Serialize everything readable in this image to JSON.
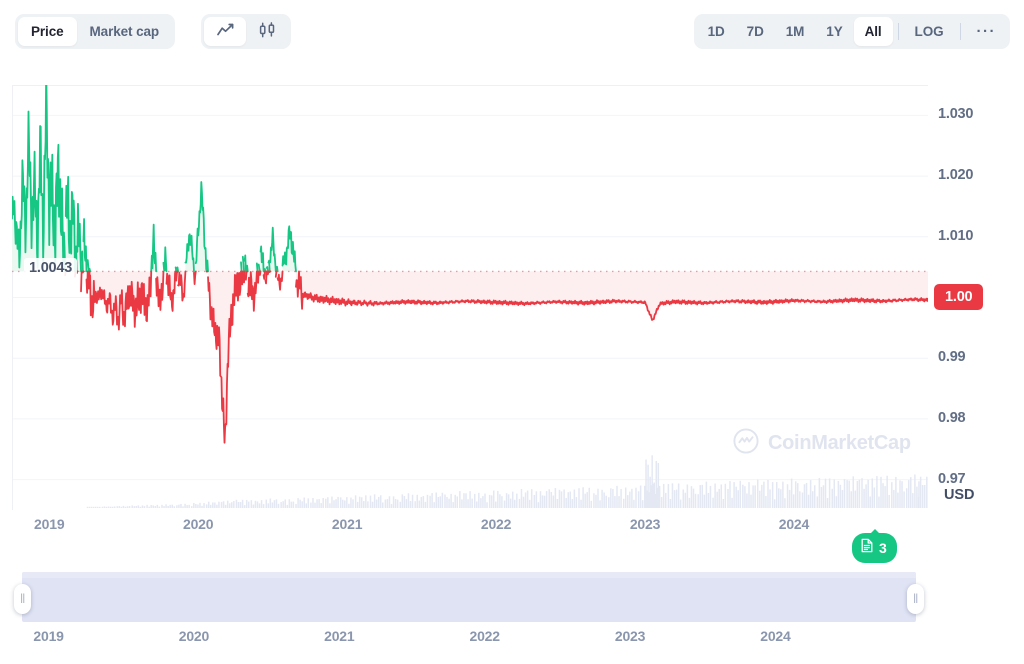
{
  "toolbar": {
    "metric_toggle": [
      {
        "label": "Price",
        "active": true,
        "name": "price"
      },
      {
        "label": "Market cap",
        "active": false,
        "name": "market-cap"
      }
    ],
    "chart_type_toggle": [
      {
        "icon": "line-chart-icon",
        "active": true,
        "name": "line"
      },
      {
        "icon": "candlestick-chart-icon",
        "active": false,
        "name": "candlestick"
      }
    ],
    "ranges": [
      {
        "label": "1D",
        "active": false
      },
      {
        "label": "7D",
        "active": false
      },
      {
        "label": "1M",
        "active": false
      },
      {
        "label": "1Y",
        "active": false
      },
      {
        "label": "All",
        "active": true
      }
    ],
    "log_label": "LOG",
    "more_label": "···"
  },
  "watermark": {
    "text": "CoinMarketCap",
    "logo": "coinmarketcap-logo-icon"
  },
  "news_badge": {
    "count": "3",
    "icon": "news-document-icon"
  },
  "annotations": {
    "price_flag": "1.0043",
    "current_price_badge": "1.00",
    "currency_unit": "USD"
  },
  "colors": {
    "up": "#16c784",
    "down": "#ea3943",
    "up_fill": "#eaf8f1",
    "down_fill": "#fdeef0",
    "grid": "#f2f4f7",
    "volume": "#e4e8f3",
    "badge_red": "#ea3943",
    "badge_green": "#16c784",
    "slider_track": "#dfe3f4",
    "text_muted": "#8a96ad"
  },
  "chart_data": {
    "type": "line",
    "title": "",
    "xlabel": "",
    "ylabel": "USD",
    "grid": true,
    "legend": "none",
    "ylim": [
      0.965,
      1.035
    ],
    "yticks": [
      "1.030",
      "1.020",
      "1.010",
      "1.00",
      "0.99",
      "0.98",
      "0.97"
    ],
    "ytick_values": [
      1.03,
      1.02,
      1.01,
      1.0,
      0.99,
      0.98,
      0.97
    ],
    "xticks": [
      "2019",
      "2020",
      "2021",
      "2022",
      "2023",
      "2024"
    ],
    "xtick_values": [
      2019,
      2020,
      2021,
      2022,
      2023,
      2024
    ],
    "xlim": [
      2018.75,
      2024.9
    ],
    "reference_line": 1.0043,
    "reference_line_label": "1.0043",
    "series": [
      {
        "name": "Price (USD)",
        "color_above_reference": "#16c784",
        "color_below_reference": "#ea3943",
        "x": [
          2018.78,
          2018.8,
          2018.82,
          2018.84,
          2018.86,
          2018.88,
          2018.9,
          2018.92,
          2018.94,
          2018.96,
          2018.98,
          2019.0,
          2019.02,
          2019.04,
          2019.06,
          2019.08,
          2019.1,
          2019.12,
          2019.14,
          2019.16,
          2019.18,
          2019.2,
          2019.22,
          2019.24,
          2019.26,
          2019.28,
          2019.3,
          2019.32,
          2019.34,
          2019.36,
          2019.38,
          2019.4,
          2019.42,
          2019.44,
          2019.46,
          2019.48,
          2019.5,
          2019.54,
          2019.58,
          2019.62,
          2019.66,
          2019.7,
          2019.74,
          2019.78,
          2019.82,
          2019.86,
          2019.9,
          2019.94,
          2019.98,
          2020.02,
          2020.06,
          2020.1,
          2020.14,
          2020.18,
          2020.2,
          2020.22,
          2020.24,
          2020.26,
          2020.28,
          2020.3,
          2020.34,
          2020.38,
          2020.42,
          2020.46,
          2020.5,
          2020.54,
          2020.58,
          2020.62,
          2020.66,
          2020.7,
          2020.8,
          2020.9,
          2021.0,
          2021.2,
          2021.4,
          2021.6,
          2021.8,
          2022.0,
          2022.2,
          2022.4,
          2022.6,
          2022.8,
          2023.0,
          2023.05,
          2023.1,
          2023.2,
          2023.4,
          2023.6,
          2023.8,
          2024.0,
          2024.2,
          2024.4,
          2024.6,
          2024.8,
          2024.88
        ],
        "y": [
          1.013,
          1.0048,
          1.0215,
          1.01,
          1.027,
          1.013,
          1.019,
          1.009,
          1.025,
          1.011,
          1.032,
          1.015,
          1.018,
          1.0095,
          1.023,
          1.012,
          1.008,
          1.016,
          1.01,
          1.0145,
          1.006,
          1.011,
          1.005,
          1.009,
          1.003,
          1.0005,
          0.9985,
          1.0012,
          0.9995,
          1.002,
          0.9975,
          1.0008,
          0.9965,
          0.999,
          0.996,
          0.9995,
          0.997,
          1.0008,
          0.998,
          1.001,
          0.9975,
          1.009,
          0.9985,
          1.006,
          0.999,
          1.0045,
          1.0002,
          1.011,
          1.0035,
          1.018,
          1.004,
          0.9955,
          0.993,
          0.9755,
          0.9905,
          0.9965,
          0.9998,
          1.0035,
          1.0008,
          1.006,
          1.002,
          1.0005,
          1.007,
          1.003,
          1.0095,
          1.0018,
          1.006,
          1.011,
          1.003,
          1.0005,
          0.9998,
          0.9995,
          0.9992,
          0.999,
          0.9993,
          0.9991,
          0.9994,
          0.9992,
          0.999,
          0.9993,
          0.9991,
          0.9994,
          0.9992,
          0.9962,
          0.999,
          0.9993,
          0.9991,
          0.9994,
          0.9992,
          0.9995,
          0.9993,
          0.9996,
          0.9994,
          0.9997,
          0.9996
        ]
      }
    ],
    "volume": {
      "name": "Volume",
      "color": "#e4e8f3",
      "x": [
        2019.3,
        2019.4,
        2019.5,
        2019.6,
        2019.7,
        2019.8,
        2019.9,
        2020.0,
        2020.1,
        2020.2,
        2020.3,
        2020.4,
        2020.5,
        2020.6,
        2020.7,
        2020.8,
        2020.9,
        2021.0,
        2021.1,
        2021.2,
        2021.3,
        2021.4,
        2021.5,
        2021.6,
        2021.7,
        2021.8,
        2021.9,
        2022.0,
        2022.1,
        2022.2,
        2022.3,
        2022.4,
        2022.5,
        2022.6,
        2022.7,
        2022.8,
        2022.9,
        2023.0,
        2023.05,
        2023.1,
        2023.2,
        2023.3,
        2023.4,
        2023.5,
        2023.6,
        2023.7,
        2023.8,
        2023.9,
        2024.0,
        2024.1,
        2024.2,
        2024.3,
        2024.4,
        2024.5,
        2024.6,
        2024.7,
        2024.8,
        2024.88
      ],
      "values": [
        2,
        3,
        4,
        5,
        6,
        7,
        8,
        10,
        12,
        14,
        16,
        15,
        18,
        17,
        20,
        19,
        22,
        21,
        24,
        26,
        23,
        28,
        25,
        30,
        27,
        32,
        29,
        34,
        31,
        36,
        33,
        38,
        35,
        40,
        37,
        42,
        39,
        44,
        100,
        46,
        48,
        45,
        50,
        47,
        52,
        49,
        54,
        51,
        56,
        53,
        58,
        55,
        60,
        57,
        62,
        59,
        64,
        61
      ]
    }
  }
}
